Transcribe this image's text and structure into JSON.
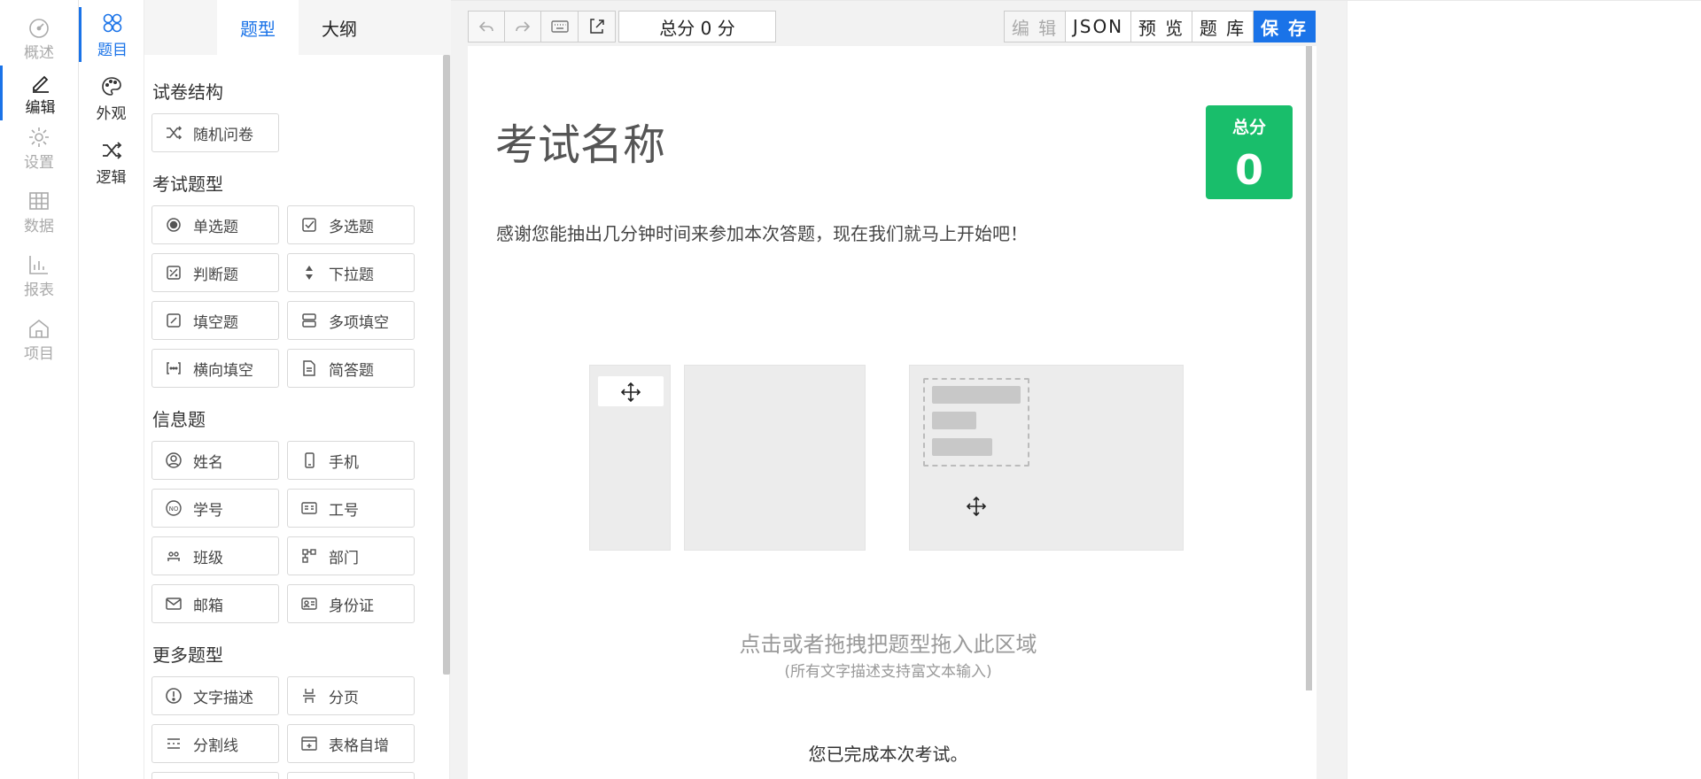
{
  "nav": {
    "items": [
      {
        "label": "概述",
        "icon": "dashboard-icon"
      },
      {
        "label": "编辑",
        "icon": "pen-icon"
      },
      {
        "label": "设置",
        "icon": "gear-icon"
      },
      {
        "label": "数据",
        "icon": "table-icon"
      },
      {
        "label": "报表",
        "icon": "bar-chart-icon"
      },
      {
        "label": "项目",
        "icon": "home-icon"
      }
    ],
    "active": "编辑"
  },
  "subnav": {
    "items": [
      {
        "label": "题目",
        "icon": "circles-icon"
      },
      {
        "label": "外观",
        "icon": "palette-icon"
      },
      {
        "label": "逻辑",
        "icon": "shuffle-icon"
      }
    ],
    "active": "题目"
  },
  "panel": {
    "tabs": [
      "题型",
      "大纲"
    ],
    "active_tab": "题型",
    "sections": [
      {
        "title": "试卷结构",
        "items": [
          "随机问卷"
        ]
      },
      {
        "title": "考试题型",
        "items": [
          "单选题",
          "多选题",
          "判断题",
          "下拉题",
          "填空题",
          "多项填空",
          "横向填空",
          "简答题"
        ]
      },
      {
        "title": "信息题",
        "items": [
          "姓名",
          "手机",
          "学号",
          "工号",
          "班级",
          "部门",
          "邮箱",
          "身份证"
        ]
      },
      {
        "title": "更多题型",
        "items": [
          "文字描述",
          "分页",
          "分割线",
          "表格自增"
        ]
      }
    ]
  },
  "toolbar": {
    "total_score": "总分 0 分",
    "buttons": [
      "编 辑",
      "JSON",
      "预 览",
      "题 库",
      "保 存"
    ]
  },
  "exam": {
    "title": "考试名称",
    "score_label": "总分",
    "score_value": "0",
    "description": "感谢您能抽出几分钟时间来参加本次答题，现在我们就马上开始吧！",
    "drop_hint": "点击或者拖拽把题型拖入此区域",
    "drop_sub": "(所有文字描述支持富文本输入)",
    "finish_text": "您已完成本次考试。"
  },
  "colors": {
    "accent": "#1a73e8",
    "score_card": "#19be6b",
    "save_button": "#1a73e8"
  }
}
